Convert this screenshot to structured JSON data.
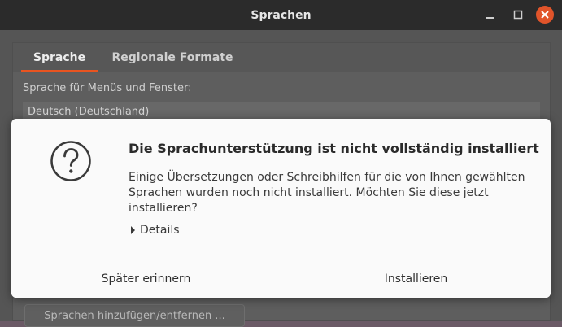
{
  "window": {
    "title": "Sprachen",
    "controls": {
      "minimize": "–",
      "maximize": "▫",
      "close": "×"
    }
  },
  "tabs": [
    {
      "label": "Sprache",
      "active": true
    },
    {
      "label": "Regionale Formate",
      "active": false
    }
  ],
  "language_section": {
    "label": "Sprache für Menüs und Fenster:",
    "selected_language": "Deutsch (Deutschland)",
    "add_remove_button": "Sprachen hinzufügen/entfernen ..."
  },
  "dialog": {
    "icon": "question-icon",
    "title": "Die Sprachunterstützung ist nicht vollständig installiert",
    "body": "Einige Übersetzungen oder Schreibhilfen für die von Ihnen gewählten Sprachen wurden noch nicht installiert. Möchten Sie diese jetzt installieren?",
    "details_label": "Details",
    "remind_later_button": "Später erinnern",
    "install_button": "Installieren"
  },
  "colors": {
    "accent": "#e95420",
    "dialog_bg": "#fafafa",
    "titlebar_bg": "#2b2b2b"
  }
}
